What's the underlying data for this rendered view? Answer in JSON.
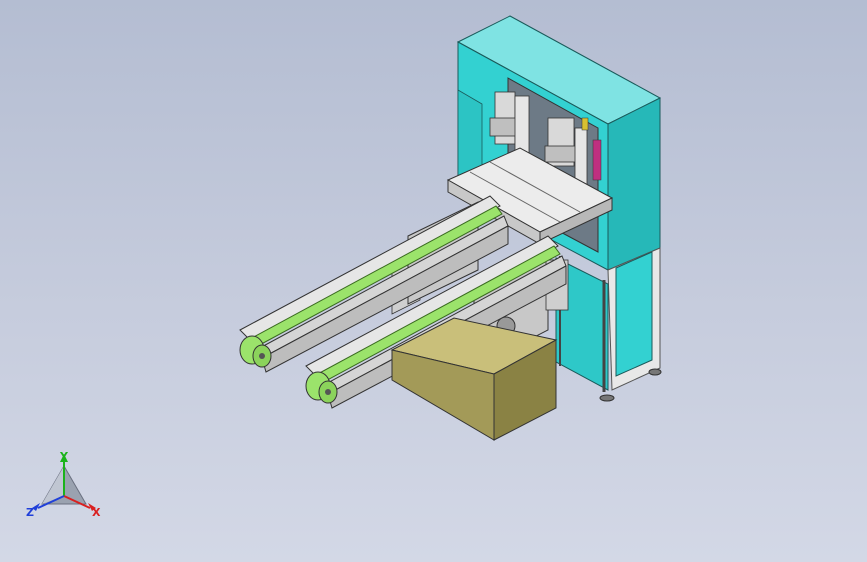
{
  "viewport": {
    "background_top": "#b4bdd2",
    "background_bottom": "#d3d8e6"
  },
  "model": {
    "cabinet_color": "#33d1d1",
    "frame_color": "#e6e6e6",
    "belt_color": "#9be36b",
    "conveyor_body_color": "#dcdcdc",
    "box_color": "#a39a58"
  },
  "triad": {
    "x_label": "X",
    "y_label": "Y",
    "z_label": "Z",
    "x_color": "#d92020",
    "y_color": "#1bb31b",
    "z_color": "#2040d9"
  }
}
